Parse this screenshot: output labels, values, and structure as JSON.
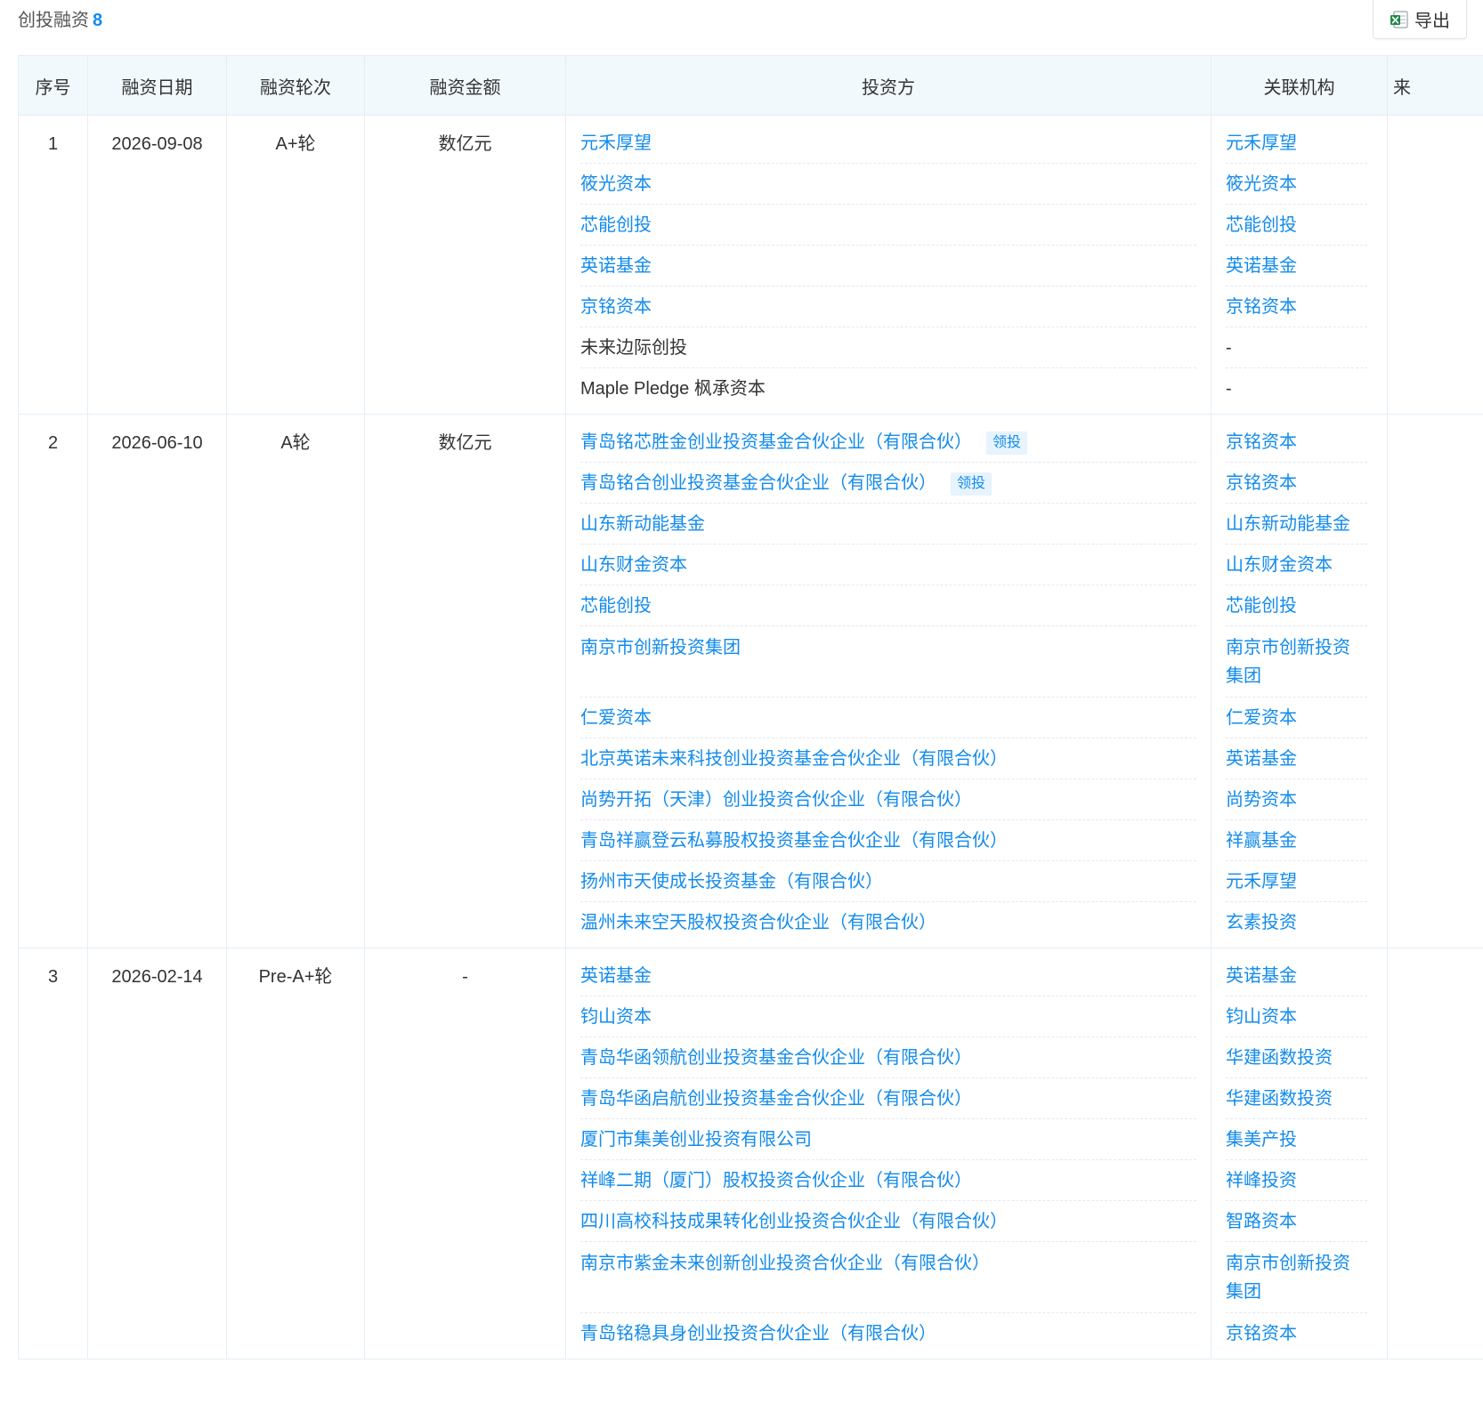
{
  "section": {
    "title": "创投融资",
    "count": "8",
    "export_label": "导出",
    "export_icon": "excel-icon"
  },
  "columns": [
    "序号",
    "融资日期",
    "融资轮次",
    "融资金额",
    "投资方",
    "关联机构",
    "来"
  ],
  "accent_color": "#128bed",
  "lead_tag": "领投",
  "rounds": [
    {
      "index": "1",
      "date": "2026-09-08",
      "round": "A+轮",
      "amount": "数亿元",
      "investors": [
        {
          "name": "元禾厚望",
          "link": true,
          "org": "元禾厚望",
          "org_link": true
        },
        {
          "name": "筱光资本",
          "link": true,
          "org": "筱光资本",
          "org_link": true
        },
        {
          "name": "芯能创投",
          "link": true,
          "org": "芯能创投",
          "org_link": true
        },
        {
          "name": "英诺基金",
          "link": true,
          "org": "英诺基金",
          "org_link": true
        },
        {
          "name": "京铭资本",
          "link": true,
          "org": "京铭资本",
          "org_link": true
        },
        {
          "name": "未来边际创投",
          "link": false,
          "org": "-",
          "org_link": false
        },
        {
          "name": "Maple Pledge 枫承资本",
          "link": false,
          "org": "-",
          "org_link": false
        }
      ]
    },
    {
      "index": "2",
      "date": "2026-06-10",
      "round": "A轮",
      "amount": "数亿元",
      "investors": [
        {
          "name": "青岛铭芯胜金创业投资基金合伙企业（有限合伙）",
          "link": true,
          "lead": true,
          "org": "京铭资本",
          "org_link": true
        },
        {
          "name": "青岛铭合创业投资基金合伙企业（有限合伙）",
          "link": true,
          "lead": true,
          "org": "京铭资本",
          "org_link": true
        },
        {
          "name": "山东新动能基金",
          "link": true,
          "org": "山东新动能基金",
          "org_link": true
        },
        {
          "name": "山东财金资本",
          "link": true,
          "org": "山东财金资本",
          "org_link": true
        },
        {
          "name": "芯能创投",
          "link": true,
          "org": "芯能创投",
          "org_link": true
        },
        {
          "name": "南京市创新投资集团",
          "link": true,
          "org": "南京市创新投资集团",
          "org_link": true,
          "tall": true
        },
        {
          "name": "仁爱资本",
          "link": true,
          "org": "仁爱资本",
          "org_link": true
        },
        {
          "name": "北京英诺未来科技创业投资基金合伙企业（有限合伙）",
          "link": true,
          "org": "英诺基金",
          "org_link": true
        },
        {
          "name": "尚势开拓（天津）创业投资合伙企业（有限合伙）",
          "link": true,
          "org": "尚势资本",
          "org_link": true
        },
        {
          "name": "青岛祥赢登云私募股权投资基金合伙企业（有限合伙）",
          "link": true,
          "org": "祥赢基金",
          "org_link": true
        },
        {
          "name": "扬州市天使成长投资基金（有限合伙）",
          "link": true,
          "org": "元禾厚望",
          "org_link": true
        },
        {
          "name": "温州未来空天股权投资合伙企业（有限合伙）",
          "link": true,
          "org": "玄素投资",
          "org_link": true
        }
      ]
    },
    {
      "index": "3",
      "date": "2026-02-14",
      "round": "Pre-A+轮",
      "amount": "-",
      "investors": [
        {
          "name": "英诺基金",
          "link": true,
          "org": "英诺基金",
          "org_link": true
        },
        {
          "name": "钧山资本",
          "link": true,
          "org": "钧山资本",
          "org_link": true
        },
        {
          "name": "青岛华函领航创业投资基金合伙企业（有限合伙）",
          "link": true,
          "org": "华建函数投资",
          "org_link": true
        },
        {
          "name": "青岛华函启航创业投资基金合伙企业（有限合伙）",
          "link": true,
          "org": "华建函数投资",
          "org_link": true
        },
        {
          "name": "厦门市集美创业投资有限公司",
          "link": true,
          "org": "集美产投",
          "org_link": true
        },
        {
          "name": "祥峰二期（厦门）股权投资合伙企业（有限合伙）",
          "link": true,
          "org": "祥峰投资",
          "org_link": true
        },
        {
          "name": "四川高校科技成果转化创业投资合伙企业（有限合伙）",
          "link": true,
          "org": "智路资本",
          "org_link": true
        },
        {
          "name": "南京市紫金未来创新创业投资合伙企业（有限合伙）",
          "link": true,
          "org": "南京市创新投资集团",
          "org_link": true,
          "tall": true
        },
        {
          "name": "青岛铭稳具身创业投资合伙企业（有限合伙）",
          "link": true,
          "org": "京铭资本",
          "org_link": true
        }
      ]
    }
  ]
}
